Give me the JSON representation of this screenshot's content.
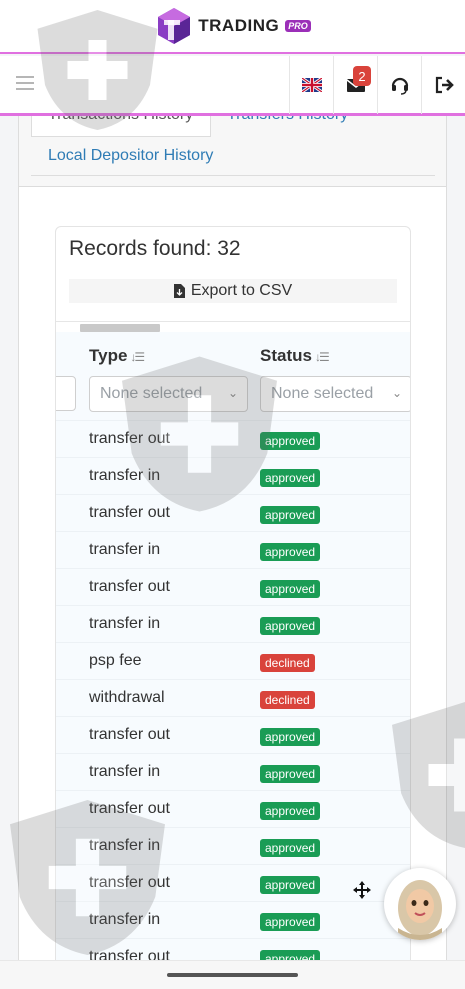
{
  "header": {
    "brand": "TRADING",
    "brand_badge": "PRO",
    "accent": "#e070e0"
  },
  "nav": {
    "icons": [
      "language-flag-icon",
      "mail-icon",
      "support-headset-icon",
      "logout-icon"
    ],
    "mail_badge": "2"
  },
  "tabs": {
    "transactions": "Transactions History",
    "transfers": "Transfers History",
    "local": "Local Depositor History"
  },
  "records": {
    "title": "Records found: 32",
    "export_label": "Export to CSV"
  },
  "table": {
    "columns": [
      "Type",
      "Status"
    ],
    "filters": [
      "None selected",
      "None selected"
    ],
    "rows": [
      {
        "type": "transfer out",
        "status": "approved"
      },
      {
        "type": "transfer in",
        "status": "approved"
      },
      {
        "type": "transfer out",
        "status": "approved"
      },
      {
        "type": "transfer in",
        "status": "approved"
      },
      {
        "type": "transfer out",
        "status": "approved"
      },
      {
        "type": "transfer in",
        "status": "approved"
      },
      {
        "type": "psp fee",
        "status": "declined"
      },
      {
        "type": "withdrawal",
        "status": "declined"
      },
      {
        "type": "transfer out",
        "status": "approved"
      },
      {
        "type": "transfer in",
        "status": "approved"
      },
      {
        "type": "transfer out",
        "status": "approved"
      },
      {
        "type": "transfer in",
        "status": "approved"
      },
      {
        "type": "transfer out",
        "status": "approved"
      },
      {
        "type": "transfer in",
        "status": "approved"
      },
      {
        "type": "transfer out",
        "status": "approved"
      }
    ],
    "status_colors": {
      "approved": "#1a9c55",
      "declined": "#d9433b"
    }
  }
}
